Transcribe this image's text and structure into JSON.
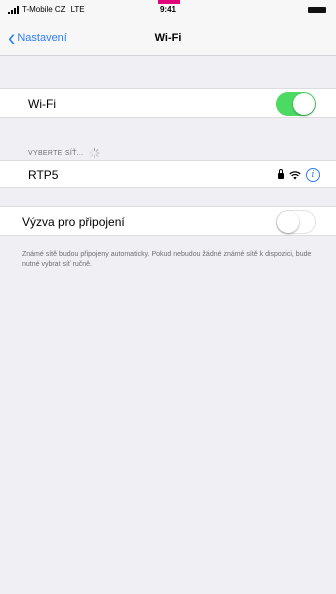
{
  "status_bar": {
    "carrier": "T-Mobile CZ",
    "network": "LTE",
    "time": "9:41"
  },
  "nav": {
    "back_label": "Nastavení",
    "title": "Wi-Fi"
  },
  "wifi_row": {
    "label": "Wi-Fi",
    "enabled": true
  },
  "networks_section": {
    "header": "VYBERTE SÍŤ...",
    "items": [
      {
        "name": "RTP5",
        "secured": true
      }
    ]
  },
  "ask_to_join": {
    "label": "Výzva pro připojení",
    "enabled": false,
    "note": "Známé sítě budou připojeny automaticky. Pokud nebudou žádné známé sítě k dispozici, bude nutné vybrat síť ručně."
  },
  "colors": {
    "accent": "#2f7df6",
    "toggle_on": "#4cd964",
    "brand_tab": "#e4007a"
  }
}
